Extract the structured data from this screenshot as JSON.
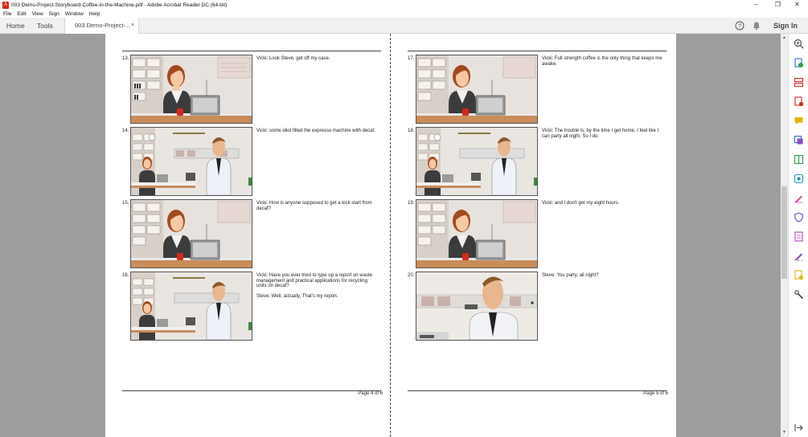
{
  "window": {
    "title": "003 Demo-Project-Storyboard-Coffee-in-the-Machine.pdf - Adobe Acrobat Reader DC (64-bit)",
    "minimize": "–",
    "restore": "❐",
    "close": "✕"
  },
  "menu": [
    "File",
    "Edit",
    "View",
    "Sign",
    "Window",
    "Help"
  ],
  "tabs": {
    "home": "Home",
    "tools": "Tools",
    "document": "003 Demo-Project-...",
    "document_close": "×",
    "signin": "Sign In"
  },
  "pages": [
    {
      "page_label": "Page 4 of 6",
      "panels": [
        {
          "num": "13.",
          "scene": "vicki",
          "lines": [
            "Vicki: Look Steve, get off my case."
          ]
        },
        {
          "num": "14.",
          "scene": "wide",
          "lines": [
            "Vicki: some idiot filled the expresso machine with decaf."
          ]
        },
        {
          "num": "15.",
          "scene": "vicki",
          "lines": [
            "Vicki: How is anyone supposed to get a kick start from decaf?"
          ]
        },
        {
          "num": "16.",
          "scene": "wide",
          "lines": [
            "Vicki: Have you ever tried to type up a report on waste management and practical applications for recycling units on decaf?",
            "Steve: Well, actually, That's my report."
          ]
        }
      ]
    },
    {
      "page_label": "Page 5 of 6",
      "panels": [
        {
          "num": "17.",
          "scene": "vicki",
          "lines": [
            "Vicki: Full strength coffee is the only thing that keeps me awake."
          ]
        },
        {
          "num": "18.",
          "scene": "wide",
          "lines": [
            "Vicki: The trouble is, by the time I get home, I feel like I can party all night. So I do."
          ]
        },
        {
          "num": "19.",
          "scene": "vicki",
          "lines": [
            "Vicki: and I don't get my eight hours."
          ]
        },
        {
          "num": "20.",
          "scene": "steve",
          "lines": [
            "Steve: You party, all night?"
          ]
        }
      ]
    }
  ],
  "colors": {
    "accent_red": "#d9261c",
    "tool_purple": "#8a4fc6",
    "tool_green": "#2e9b4a",
    "tool_blue": "#2f6fd1",
    "tool_yellow": "#e2b400",
    "tool_teal": "#1a9aa8"
  }
}
